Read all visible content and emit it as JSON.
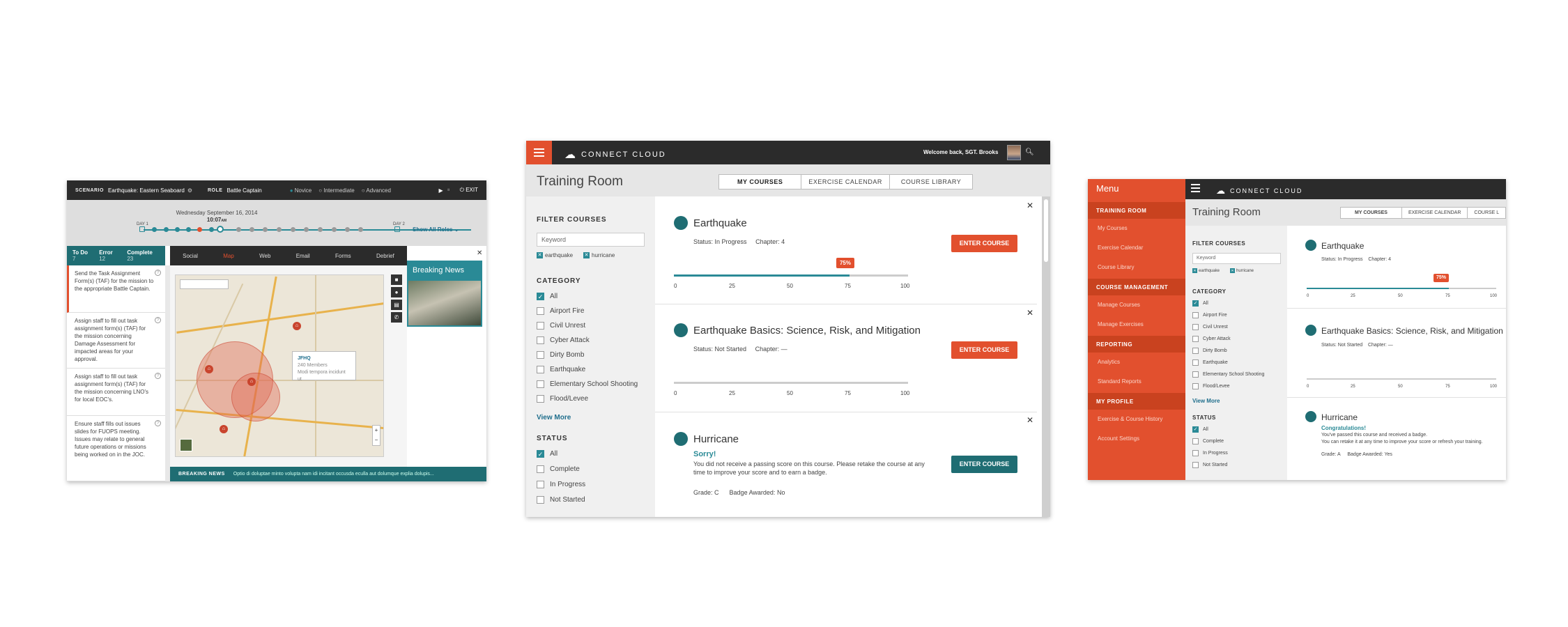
{
  "s1": {
    "topbar": {
      "scenario_label": "SCENARIO",
      "scenario": "Earthquake: Eastern Seaboard",
      "role_label": "ROLE",
      "role": "Battle Captain",
      "levels": [
        "Novice",
        "Intermediate",
        "Advanced"
      ],
      "exit": "EXIT"
    },
    "timeline": {
      "date": "Wednesday September 16, 2014",
      "time": "10:07",
      "ampm": "AM",
      "day_start": "DAY 1",
      "day_end": "DAY 2",
      "show_all": "Show All Roles"
    },
    "tasks_tabs": {
      "todo": "To Do",
      "todo_n": "7",
      "error": "Error",
      "error_n": "12",
      "complete": "Complete",
      "complete_n": "23"
    },
    "tasks": [
      "Send the Task Assignment Form(s) (TAF) for the mission to the appropriate Battle Captain.",
      "Assign staff to fill out task assignment form(s) (TAF) for the mission concerning Damage Assessment for impacted areas for your approval.",
      "Assign staff to fill out task assignment form(s) (TAF) for the mission concerning LNO's for local EOC's.",
      "Ensure staff fills out issues slides for FUOPS meeting. Issues may relate to general future operations or missions being worked on in the JOC."
    ],
    "tabs": [
      "Social",
      "Map",
      "Web",
      "Email",
      "Forms",
      "Debrief"
    ],
    "popup": {
      "title": "JFHQ",
      "line1": "240 Members",
      "line2": "Modi tempora incidunt ut"
    },
    "breaking_news": "Breaking News",
    "ticker": {
      "label": "BREAKING NEWS",
      "text": "Optio di doluptae minto volupta nam idi incitant occusda eculla aut dolumque explia dolupis..."
    }
  },
  "s2": {
    "logo": "CONNECT CLOUD",
    "welcome": "Welcome back, SGT. Brooks",
    "title": "Training Room",
    "tabs": [
      "MY COURSES",
      "EXERCISE CALENDAR",
      "COURSE LIBRARY"
    ],
    "filter": {
      "heading": "FILTER COURSES",
      "keyword": "Keyword",
      "chips": [
        "earthquake",
        "hurricane"
      ],
      "category_heading": "CATEGORY",
      "categories": [
        "All",
        "Airport Fire",
        "Civil Unrest",
        "Cyber Attack",
        "Dirty Bomb",
        "Earthquake",
        "Elementary School Shooting",
        "Flood/Levee"
      ],
      "view_more": "View More",
      "status_heading": "STATUS",
      "statuses": [
        "All",
        "Complete",
        "In Progress",
        "Not Started"
      ]
    },
    "courses": [
      {
        "title": "Earthquake",
        "status_label": "Status:",
        "status": "In Progress",
        "chapter_label": "Chapter:",
        "chapter": "4",
        "progress": 75,
        "progress_label": "75%",
        "button": "ENTER COURSE"
      },
      {
        "title": "Earthquake Basics: Science, Risk, and Mitigation",
        "status_label": "Status:",
        "status": "Not Started",
        "chapter_label": "Chapter:",
        "chapter": "—",
        "progress": 0,
        "button": "ENTER COURSE"
      },
      {
        "title": "Hurricane",
        "msg_title": "Sorry!",
        "msg": "You did not receive a passing score on this course. Please retake the course at any time to improve your score and to earn a badge.",
        "grade_label": "Grade:",
        "grade": "C",
        "badge_label": "Badge Awarded:",
        "badge": "No",
        "button": "ENTER COURSE"
      }
    ],
    "ticks": [
      "0",
      "25",
      "50",
      "75",
      "100"
    ]
  },
  "s3": {
    "menu": {
      "title": "Menu",
      "sections": [
        {
          "head": "TRAINING ROOM",
          "items": [
            "My Courses",
            "Exercise Calendar",
            "Course Library"
          ]
        },
        {
          "head": "COURSE MANAGEMENT",
          "items": [
            "Manage Courses",
            "Manage Exercises"
          ]
        },
        {
          "head": "REPORTING",
          "items": [
            "Analytics",
            "Standard Reports"
          ]
        },
        {
          "head": "MY PROFILE",
          "items": [
            "Exercise & Course History",
            "Account Settings"
          ]
        }
      ]
    },
    "logo": "CONNECT CLOUD",
    "title": "Training Room",
    "tabs": [
      "MY COURSES",
      "EXERCISE CALENDAR",
      "COURSE L"
    ],
    "filter": {
      "heading": "FILTER COURSES",
      "keyword": "Keyword",
      "chips": [
        "earthquake",
        "hurricane"
      ],
      "category_heading": "CATEGORY",
      "categories": [
        "All",
        "Airport Fire",
        "Civil Unrest",
        "Cyber Attack",
        "Dirty Bomb",
        "Earthquake",
        "Elementary School Shooting",
        "Flood/Levee"
      ],
      "view_more": "View More",
      "status_heading": "STATUS",
      "statuses": [
        "All",
        "Complete",
        "In Progress",
        "Not Started"
      ]
    },
    "courses": [
      {
        "title": "Earthquake",
        "status_label": "Status:",
        "status": "In Progress",
        "chapter_label": "Chapter:",
        "chapter": "4",
        "progress": 75,
        "progress_label": "75%"
      },
      {
        "title": "Earthquake Basics: Science, Risk, and Mitigation",
        "status_label": "Status:",
        "status": "Not Started",
        "chapter_label": "Chapter:",
        "chapter": "—",
        "progress": 0
      },
      {
        "title": "Hurricane",
        "msg_title": "Congratulations!",
        "msg1": "You've passed this course and received a badge.",
        "msg2": "You can retake it at any time to improve your score or refresh your training.",
        "grade_label": "Grade:",
        "grade": "A",
        "badge_label": "Badge Awarded:",
        "badge": "Yes"
      }
    ],
    "ticks": [
      "0",
      "25",
      "50",
      "75",
      "100"
    ]
  },
  "colors": {
    "accent": "#e2502e",
    "teal": "#2a8a96",
    "dark": "#2b2b2b"
  }
}
